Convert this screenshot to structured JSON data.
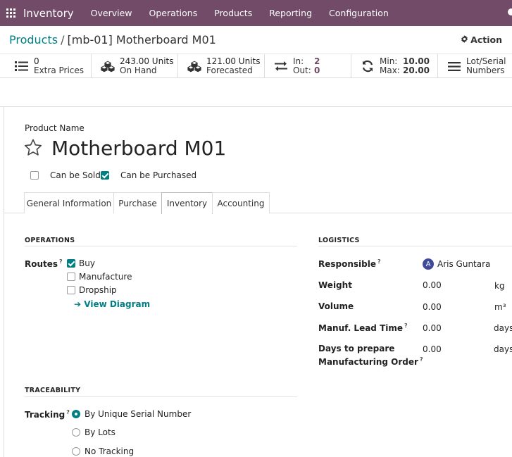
{
  "navbar": {
    "brand": "Inventory",
    "items": [
      "Overview",
      "Operations",
      "Products",
      "Reporting",
      "Configuration"
    ]
  },
  "breadcrumb": {
    "parent": "Products",
    "separator": "/",
    "current": "[mb-01] Motherboard M01"
  },
  "action_label": "Action",
  "smart_buttons": {
    "extra_prices": {
      "value": "0",
      "label": "Extra Prices"
    },
    "on_hand": {
      "value": "243.00 Units",
      "label": "On Hand"
    },
    "forecasted": {
      "value": "121.00 Units",
      "label": "Forecasted"
    },
    "in_out": {
      "in_label": "In:",
      "in_value": "2",
      "out_label": "Out:",
      "out_value": "0"
    },
    "min_max": {
      "min_label": "Min:",
      "min_value": "10.00",
      "max_label": "Max:",
      "max_value": "20.00"
    },
    "lot_serial": {
      "line1": "Lot/Serial",
      "line2": "Numbers"
    }
  },
  "form": {
    "product_name_label": "Product Name",
    "product_name": "Motherboard M01",
    "can_be_sold": {
      "label": "Can be Sold",
      "checked": false
    },
    "can_be_purchased": {
      "label": "Can be Purchased",
      "checked": true
    }
  },
  "tabs": [
    "General Information",
    "Purchase",
    "Inventory",
    "Accounting"
  ],
  "active_tab": "Inventory",
  "operations": {
    "title": "OPERATIONS",
    "routes_label": "Routes",
    "routes": [
      {
        "label": "Buy",
        "checked": true
      },
      {
        "label": "Manufacture",
        "checked": false
      },
      {
        "label": "Dropship",
        "checked": false
      }
    ],
    "view_diagram": "View Diagram"
  },
  "logistics": {
    "title": "LOGISTICS",
    "responsible_label": "Responsible",
    "responsible": "Aris Guntara",
    "responsible_initial": "A",
    "weight_label": "Weight",
    "weight": "0.00",
    "weight_unit": "kg",
    "volume_label": "Volume",
    "volume": "0.00",
    "volume_unit": "m³",
    "lead_time_label": "Manuf. Lead Time",
    "lead_time": "0.00",
    "lead_time_unit": "days",
    "days_prepare_label_1": "Days to prepare",
    "days_prepare_label_2": "Manufacturing Order",
    "days_prepare": "0.00",
    "days_prepare_unit": "days"
  },
  "traceability": {
    "title": "TRACEABILITY",
    "tracking_label": "Tracking",
    "options": [
      {
        "label": "By Unique Serial Number",
        "selected": true
      },
      {
        "label": "By Lots",
        "selected": false
      },
      {
        "label": "No Tracking",
        "selected": false
      }
    ]
  },
  "colors": {
    "brand": "#714b67",
    "accent": "#017e84",
    "avatar": "#3f4a9a"
  }
}
